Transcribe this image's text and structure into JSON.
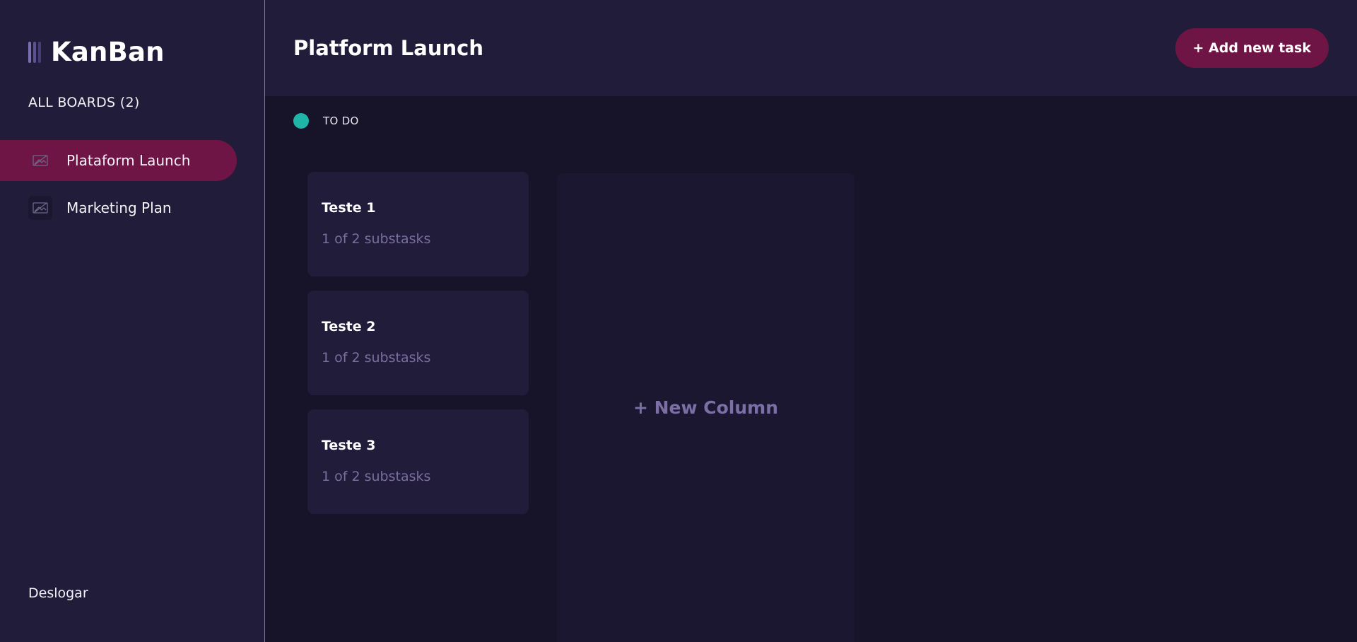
{
  "app": {
    "name": "KanBan"
  },
  "sidebar": {
    "boards_heading": "ALL BOARDS (2)",
    "boards": [
      {
        "label": "Plataform Launch",
        "active": true
      },
      {
        "label": "Marketing Plan",
        "active": false
      }
    ],
    "board_icon": "board-image-icon",
    "logout_label": "Deslogar"
  },
  "header": {
    "title": "Platform Launch",
    "add_task_label": "+ Add new task"
  },
  "columns": [
    {
      "name": "TO DO",
      "color": "#1fb5a8",
      "cards": [
        {
          "title": "Teste 1",
          "subtasks": "1 of 2 substasks"
        },
        {
          "title": "Teste 2",
          "subtasks": "1 of 2 substasks"
        },
        {
          "title": "Teste 3",
          "subtasks": "1 of 2 substasks"
        }
      ]
    }
  ],
  "new_column_label": "+ New Column",
  "colors": {
    "accent": "#6e1545",
    "sidebar_bg": "#221c3b",
    "board_bg": "#17142a",
    "muted_text": "#7a6e9e"
  }
}
